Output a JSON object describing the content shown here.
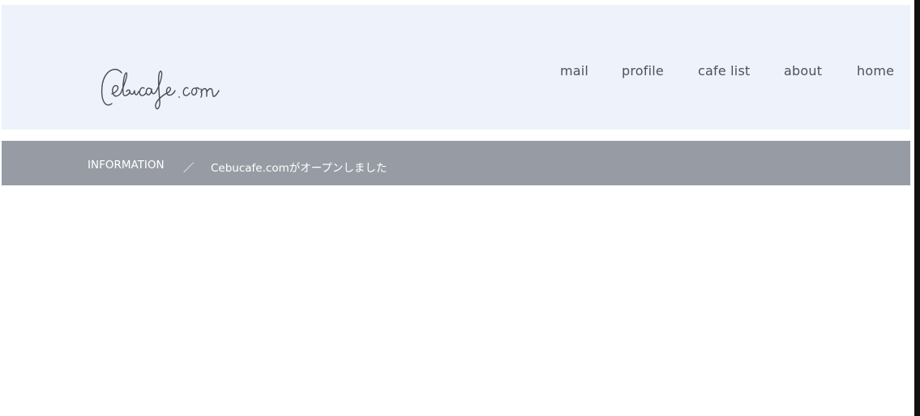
{
  "site": {
    "logo_text": "Cebucafe.com"
  },
  "nav": {
    "items": [
      {
        "label": "mail"
      },
      {
        "label": "profile"
      },
      {
        "label": "cafe list"
      },
      {
        "label": "about"
      },
      {
        "label": "home"
      }
    ]
  },
  "breadcrumb": {
    "section": "INFORMATION",
    "separator": "／",
    "current": "Cebucafe.comがオープンしました"
  },
  "colors": {
    "header_bg": "#eef2fb",
    "breadcrumb_bg": "#979ca4",
    "nav_text": "#4e5157"
  }
}
